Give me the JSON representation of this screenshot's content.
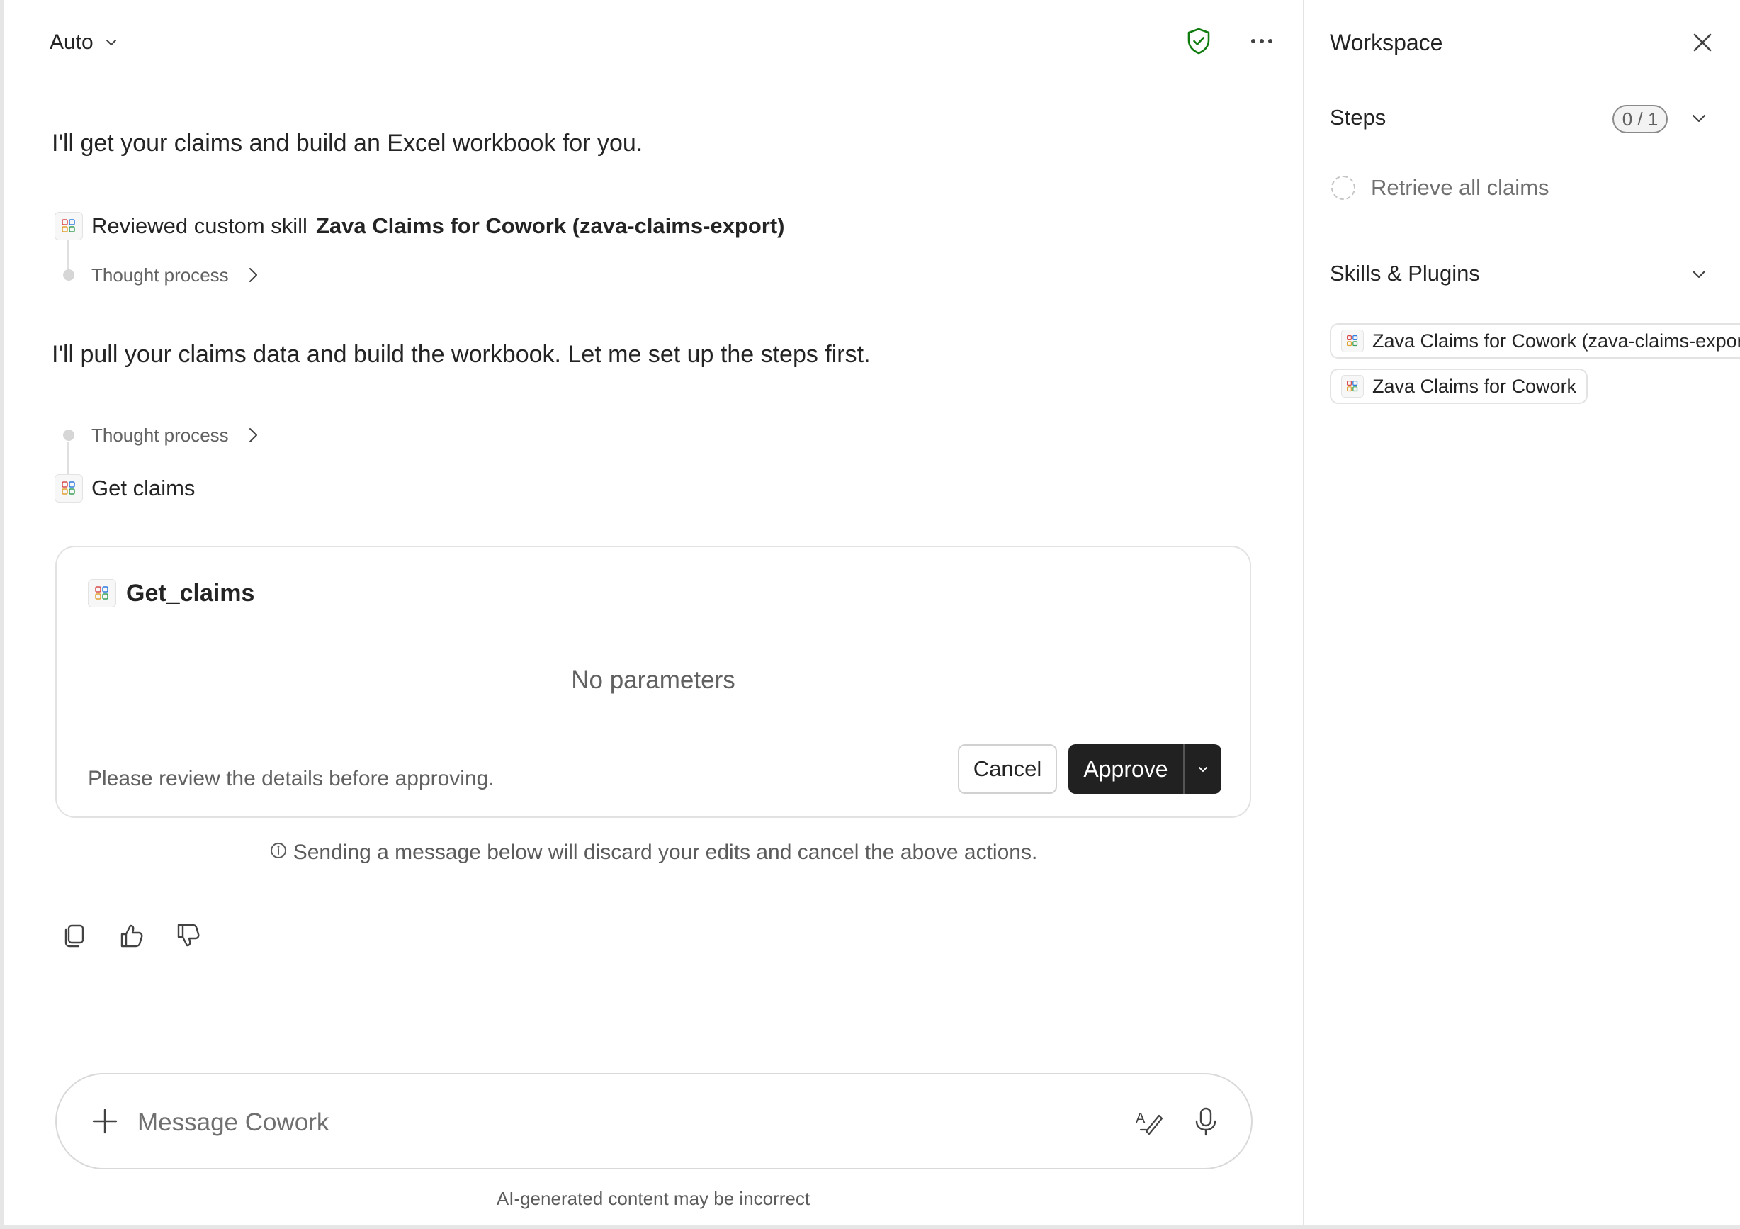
{
  "header": {
    "mode_label": "Auto",
    "shield_icon": "shield-check-icon",
    "more_icon": "more-horizontal-icon"
  },
  "conversation": {
    "message_1": "I'll get your claims and build an Excel workbook for you.",
    "skill_prefix": "Reviewed custom skill",
    "skill_name": "Zava Claims for Cowork (zava-claims-export)",
    "thought_1": "Thought process",
    "message_2": "I'll pull your claims data and build the workbook. Let me set up the steps first.",
    "thought_2": "Thought process",
    "tool_call": "Get claims"
  },
  "approval_card": {
    "title": "Get_claims",
    "no_params": "No parameters",
    "note": "Please review the details before approving.",
    "cancel_label": "Cancel",
    "approve_label": "Approve"
  },
  "info_line": "Sending a message below will discard your edits and cancel the above actions.",
  "feedback": {
    "copy_icon": "copy-icon",
    "like_icon": "thumbs-up-icon",
    "dislike_icon": "thumbs-down-icon"
  },
  "composer": {
    "placeholder": "Message Cowork",
    "value": ""
  },
  "disclaimer": "AI-generated content may be incorrect",
  "workspace": {
    "title": "Workspace",
    "steps_label": "Steps",
    "steps_count": "0 / 1",
    "steps": [
      {
        "label": "Retrieve all claims",
        "status": "pending"
      }
    ],
    "skills_label": "Skills & Plugins",
    "skills": [
      {
        "label": "Zava Claims for Cowork (zava-claims-export)"
      },
      {
        "label": "Zava Claims for Cowork"
      }
    ]
  },
  "colors": {
    "accent_dark": "#212121",
    "shield_green": "#107c10",
    "text": "#242424",
    "muted": "#616161"
  }
}
